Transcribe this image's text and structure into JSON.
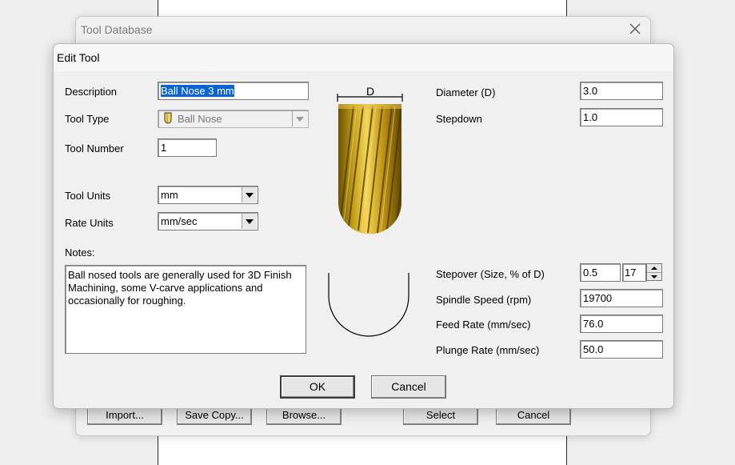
{
  "background_window": {
    "title": "Tool Database",
    "buttons": {
      "import": "Import...",
      "save_copy": "Save Copy...",
      "browse": "Browse...",
      "select": "Select",
      "cancel": "Cancel"
    }
  },
  "dialog": {
    "title": "Edit Tool",
    "description": {
      "label": "Description",
      "value": "Ball Nose 3 mm"
    },
    "tool_type": {
      "label": "Tool Type",
      "value": "Ball Nose",
      "icon": "ball-nose-tool-icon"
    },
    "tool_number": {
      "label": "Tool Number",
      "value": "1"
    },
    "tool_units": {
      "label": "Tool Units",
      "value": "mm"
    },
    "rate_units": {
      "label": "Rate Units",
      "value": "mm/sec"
    },
    "notes": {
      "label": "Notes:",
      "value": "Ball nosed tools are generally used for 3D Finish Machining, some V-carve applications and occasionally for roughing."
    },
    "diagram": {
      "dimension_label": "D"
    },
    "diameter": {
      "label": "Diameter (D)",
      "value": "3.0"
    },
    "stepdown": {
      "label": "Stepdown",
      "value": "1.0"
    },
    "stepover": {
      "label": "Stepover (Size, % of D)",
      "value": "0.5",
      "percent": "17"
    },
    "spindle_speed": {
      "label": "Spindle Speed (rpm)",
      "value": "19700"
    },
    "feed_rate": {
      "label": "Feed Rate (mm/sec)",
      "value": "76.0"
    },
    "plunge_rate": {
      "label": "Plunge Rate (mm/sec)",
      "value": "50.0"
    },
    "ok_label": "OK",
    "cancel_label": "Cancel"
  },
  "colors": {
    "selection": "#0a64d6",
    "tool_gold": "#c9a21a",
    "dialog_bg": "#f0f0f0"
  }
}
